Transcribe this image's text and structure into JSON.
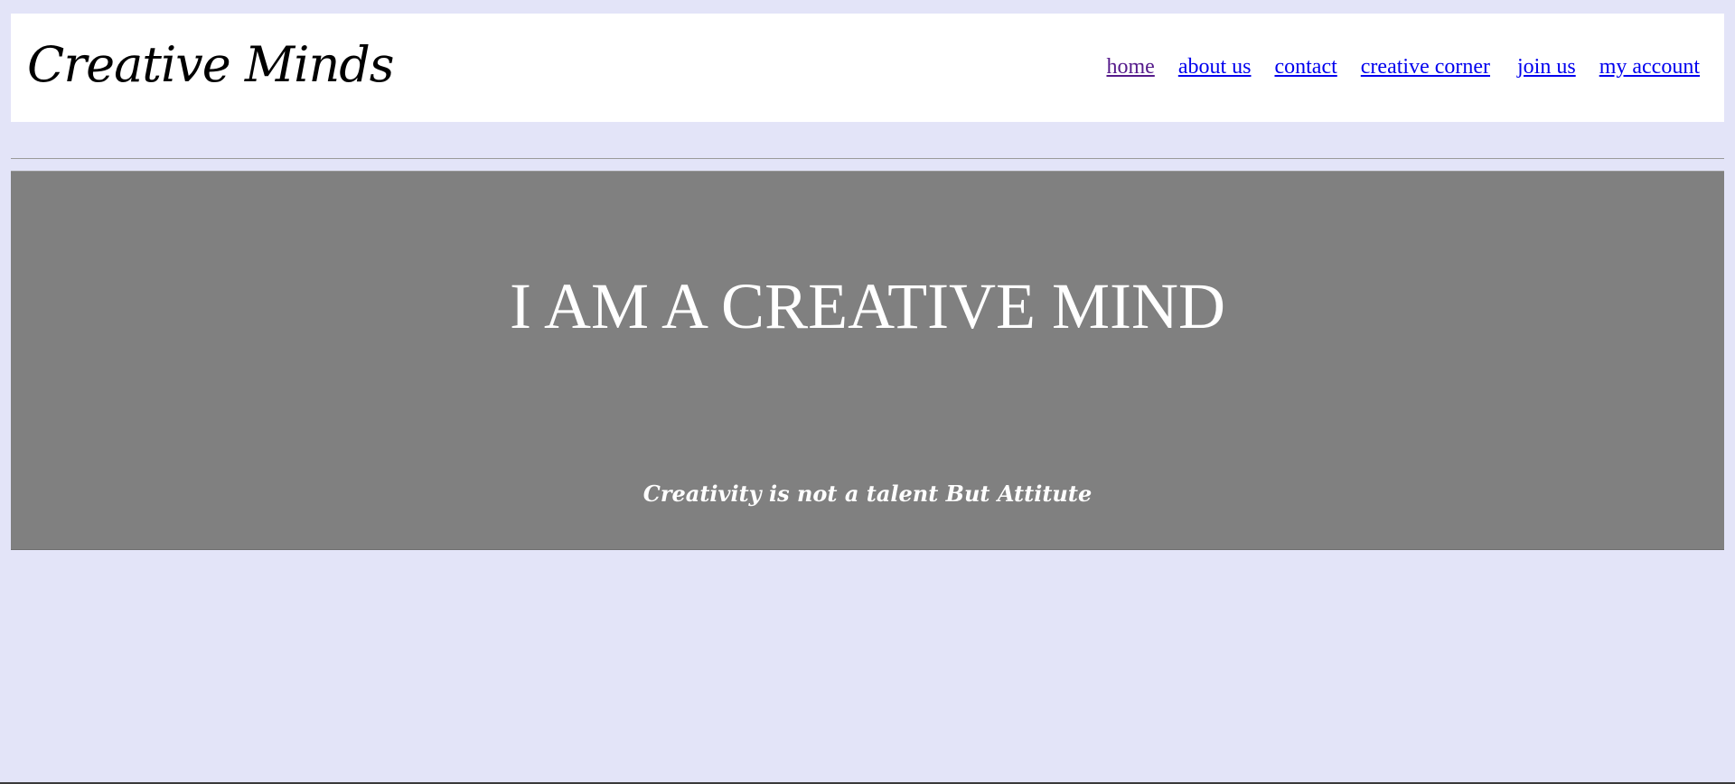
{
  "site": {
    "logo": "Creative Minds"
  },
  "nav": {
    "items": [
      {
        "label": "home",
        "visited": true
      },
      {
        "label": "about us"
      },
      {
        "label": "contact"
      },
      {
        "label": "creative corner"
      },
      {
        "label": "join us"
      },
      {
        "label": "my account"
      }
    ]
  },
  "hero": {
    "title": "I AM A CREATIVE MIND",
    "tagline": "Creativity is not a talent But Attitute"
  },
  "colors": {
    "page_background": "#e3e4f8",
    "header_background": "#ffffff",
    "hero_background": "#808080",
    "link": "#0000ee",
    "visited_link": "#551a8b"
  }
}
